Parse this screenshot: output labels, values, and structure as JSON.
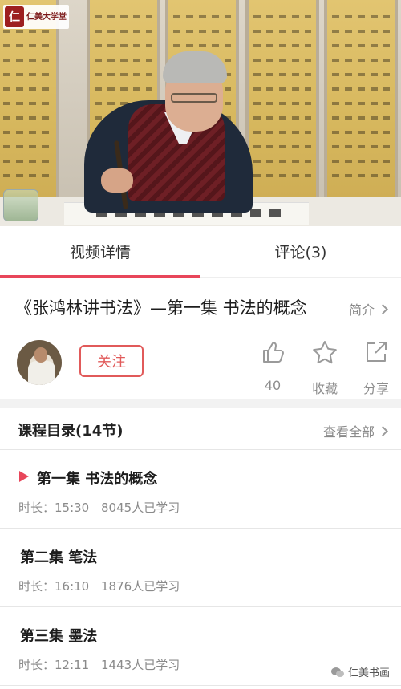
{
  "video": {
    "logo_mark": "仁",
    "logo_text": "仁美大学堂"
  },
  "tabs": [
    {
      "label": "视频详情",
      "active": true
    },
    {
      "label": "评论(3)",
      "active": false
    }
  ],
  "course": {
    "title": "《张鸿林讲书法》—第一集 书法的概念",
    "intro_label": "简介"
  },
  "author": {
    "follow_label": "关注"
  },
  "actions": {
    "like_count": "40",
    "favorite_label": "收藏",
    "share_label": "分享"
  },
  "catalog": {
    "title": "课程目录(14节)",
    "view_all_label": "查看全部",
    "lessons": [
      {
        "name": "第一集 书法的概念",
        "duration": "时长：15:30",
        "learners": "8045人已学习",
        "playing": true
      },
      {
        "name": "第二集 笔法",
        "duration": "时长：16:10",
        "learners": "1876人已学习",
        "playing": false
      },
      {
        "name": "第三集 墨法",
        "duration": "时长：12:11",
        "learners": "1443人已学习",
        "playing": false
      }
    ]
  },
  "watermark": {
    "text": "仁美书画"
  },
  "colors": {
    "accent": "#e8465a",
    "follow": "#e15a5a",
    "muted": "#8a8a8a"
  }
}
